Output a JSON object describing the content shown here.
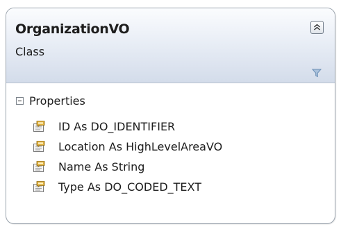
{
  "class": {
    "name": "OrganizationVO",
    "kind": "Class"
  },
  "icons": {
    "collapse": "collapse-chevrons-icon",
    "filter": "filter-icon",
    "section_toggle": "minus-box-icon",
    "property": "property-icon"
  },
  "compartment": {
    "label": "Properties",
    "items": [
      {
        "label": "ID As DO_IDENTIFIER"
      },
      {
        "label": "Location As HighLevelAreaVO"
      },
      {
        "label": "Name As String"
      },
      {
        "label": "Type As DO_CODED_TEXT"
      }
    ]
  },
  "colors": {
    "border": "#9aa3ad",
    "header_top": "#fbfcfe",
    "header_bottom": "#d3dcea",
    "text": "#1d1d1d",
    "filter": "#6b8fb5"
  }
}
